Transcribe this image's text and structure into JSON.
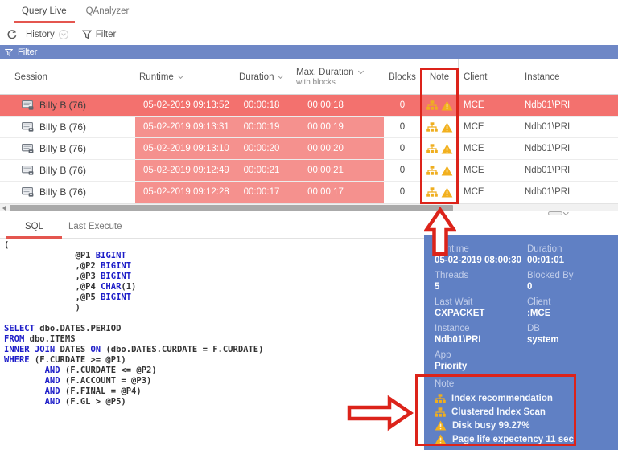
{
  "colors": {
    "annotation_red": "#dc231a",
    "tab_underline_red": "#e4564f",
    "filter_bar_blue": "#6e87c6",
    "panel_blue": "#6080c4",
    "row_selected_red": "#f3716e",
    "cell_highlight_pink": "#f5918e",
    "icon_gold": "#efae1f",
    "sql_keyword_blue": "#1c1cc8"
  },
  "main_tabs": [
    {
      "label": "Query Live",
      "active": true
    },
    {
      "label": "QAnalyzer",
      "active": false
    }
  ],
  "toolbar": {
    "history_label": "History",
    "filter_label": "Filter"
  },
  "filter_bar": {
    "label": "Filter"
  },
  "table": {
    "columns": {
      "session": "Session",
      "runtime": "Runtime",
      "duration": "Duration",
      "max_duration": "Max. Duration",
      "max_duration_sub": "with blocks",
      "blocks": "Blocks",
      "note": "Note",
      "client": "Client",
      "instance": "Instance"
    },
    "rows": [
      {
        "session": "Billy B (76)",
        "runtime": "05-02-2019 09:13:52",
        "duration": "00:00:18",
        "max_duration": "00:00:18",
        "blocks": "0",
        "note_icons": [
          "sitemap",
          "warning"
        ],
        "client": "MCE",
        "instance": "Ndb01\\PRI",
        "selected": true
      },
      {
        "session": "Billy B (76)",
        "runtime": "05-02-2019 09:13:31",
        "duration": "00:00:19",
        "max_duration": "00:00:19",
        "blocks": "0",
        "note_icons": [
          "sitemap",
          "warning"
        ],
        "client": "MCE",
        "instance": "Ndb01\\PRI",
        "selected": false
      },
      {
        "session": "Billy B (76)",
        "runtime": "05-02-2019 09:13:10",
        "duration": "00:00:20",
        "max_duration": "00:00:20",
        "blocks": "0",
        "note_icons": [
          "sitemap",
          "warning"
        ],
        "client": "MCE",
        "instance": "Ndb01\\PRI",
        "selected": false
      },
      {
        "session": "Billy B (76)",
        "runtime": "05-02-2019 09:12:49",
        "duration": "00:00:21",
        "max_duration": "00:00:21",
        "blocks": "0",
        "note_icons": [
          "sitemap",
          "warning"
        ],
        "client": "MCE",
        "instance": "Ndb01\\PRI",
        "selected": false
      },
      {
        "session": "Billy B (76)",
        "runtime": "05-02-2019 09:12:28",
        "duration": "00:00:17",
        "max_duration": "00:00:17",
        "blocks": "0",
        "note_icons": [
          "sitemap",
          "warning"
        ],
        "client": "MCE",
        "instance": "Ndb01\\PRI",
        "selected": false
      }
    ]
  },
  "sql_section": {
    "tabs": [
      {
        "label": "SQL",
        "active": true
      },
      {
        "label": "Last Execute",
        "active": false
      }
    ],
    "lines": [
      [
        [
          "(",
          0
        ]
      ],
      [
        [
          "              @P1 ",
          0
        ],
        [
          "BIGINT",
          1
        ]
      ],
      [
        [
          "              ,@P2 ",
          0
        ],
        [
          "BIGINT",
          1
        ]
      ],
      [
        [
          "              ,@P3 ",
          0
        ],
        [
          "BIGINT",
          1
        ]
      ],
      [
        [
          "              ,@P4 ",
          0
        ],
        [
          "CHAR",
          1
        ],
        [
          "(1)",
          0
        ]
      ],
      [
        [
          "              ,@P5 ",
          0
        ],
        [
          "BIGINT",
          1
        ]
      ],
      [
        [
          "              )",
          0
        ]
      ],
      [],
      [
        [
          "SELECT",
          1
        ],
        [
          " dbo.DATES.PERIOD",
          0
        ]
      ],
      [
        [
          "FROM",
          1
        ],
        [
          " dbo.ITEMS",
          0
        ]
      ],
      [
        [
          "INNER JOIN",
          1
        ],
        [
          " DATES ",
          0
        ],
        [
          "ON",
          1
        ],
        [
          " (dbo.DATES.CURDATE = F.CURDATE)",
          0
        ]
      ],
      [
        [
          "WHERE",
          1
        ],
        [
          " (F.CURDATE >= @P1)",
          0
        ]
      ],
      [
        [
          "        ",
          0
        ],
        [
          "AND",
          1
        ],
        [
          " (F.CURDATE <= @P2)",
          0
        ]
      ],
      [
        [
          "        ",
          0
        ],
        [
          "AND",
          1
        ],
        [
          " (F.ACCOUNT = @P3)",
          0
        ]
      ],
      [
        [
          "        ",
          0
        ],
        [
          "AND",
          1
        ],
        [
          " (F.FINAL = @P4)",
          0
        ]
      ],
      [
        [
          "        ",
          0
        ],
        [
          "AND",
          1
        ],
        [
          " (F.GL > @P5)",
          0
        ]
      ]
    ]
  },
  "details_panel": {
    "fields": [
      {
        "label": "Runtime",
        "value": "05-02-2019 08:00:30"
      },
      {
        "label": "Duration",
        "value": "00:01:01"
      },
      {
        "label": "Threads",
        "value": "5"
      },
      {
        "label": "Blocked By",
        "value": "0"
      },
      {
        "label": "Last Wait",
        "value": "CXPACKET"
      },
      {
        "label": "Client",
        "value": ":MCE"
      },
      {
        "label": "Instance",
        "value": "Ndb01\\PRI"
      },
      {
        "label": "DB",
        "value": "system"
      },
      {
        "label": "App",
        "value": "Priority"
      }
    ],
    "note": {
      "label": "Note",
      "items": [
        {
          "icon": "sitemap",
          "text": "Index recommendation"
        },
        {
          "icon": "sitemap",
          "text": "Clustered Index Scan"
        },
        {
          "icon": "warning",
          "text": "Disk busy 99.27%"
        },
        {
          "icon": "warning",
          "text": "Page life expectency 11 sec"
        }
      ]
    }
  }
}
